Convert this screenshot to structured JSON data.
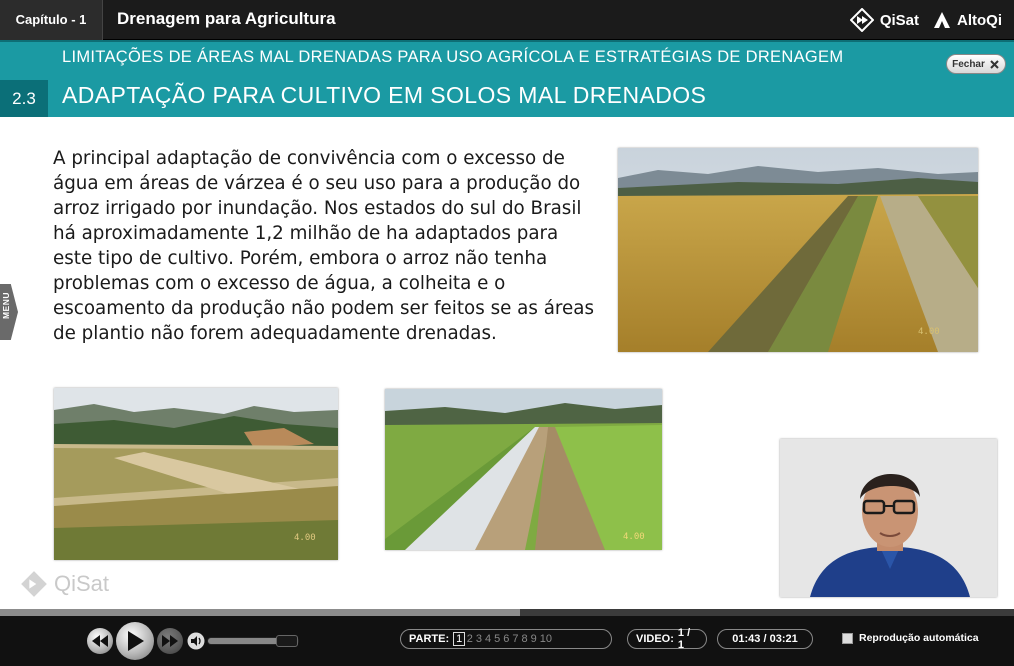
{
  "topbar": {
    "chapter": "Capítulo - 1",
    "course_title": "Drenagem para Agricultura",
    "brand_qisat": "QiSat",
    "brand_altoqi": "AltoQi"
  },
  "header": {
    "section_number": "2.3",
    "super_title": "LIMITAÇÕES DE ÁREAS MAL DRENADAS PARA USO AGRÍCOLA E ESTRATÉGIAS DE DRENAGEM",
    "title": "ADAPTAÇÃO PARA CULTIVO EM SOLOS MAL DRENADOS",
    "close_label": "Fechar"
  },
  "side_menu": {
    "label": "MENU"
  },
  "content": {
    "paragraph": "A principal adaptação de convivência com o excesso de água em áreas de várzea é o seu uso para a produção do arroz irrigado por inundação. Nos estados do sul do Brasil há aproximadamente 1,2 milhão de ha adaptados para este tipo de cultivo.  Porém, embora o arroz não tenha problemas com o excesso de água, a colheita e o escoamento da produção não podem ser feitos se as áreas de plantio não forem adequadamente drenadas.",
    "photos": [
      {
        "name": "rice-field-photo",
        "stamp": "4.00"
      },
      {
        "name": "drained-field-photo",
        "stamp": "4.00"
      },
      {
        "name": "green-rice-canal-photo",
        "stamp": "4.00"
      }
    ],
    "watermark": "QiSat"
  },
  "player": {
    "progress": 0.513,
    "volume": 0.9,
    "parts_label": "PARTE:",
    "parts": [
      "1",
      "2",
      "3",
      "4",
      "5",
      "6",
      "7",
      "8",
      "9",
      "10"
    ],
    "active_part": "1",
    "video_label": "VIDEO:",
    "video_value": "1 / 1",
    "time": "01:43 / 03:21",
    "autoplay_label": "Reprodução automática",
    "autoplay_checked": false
  },
  "colors": {
    "header_teal": "#1b9aa3",
    "section_box": "#0b6f78",
    "topbar": "#1b1b1b"
  }
}
